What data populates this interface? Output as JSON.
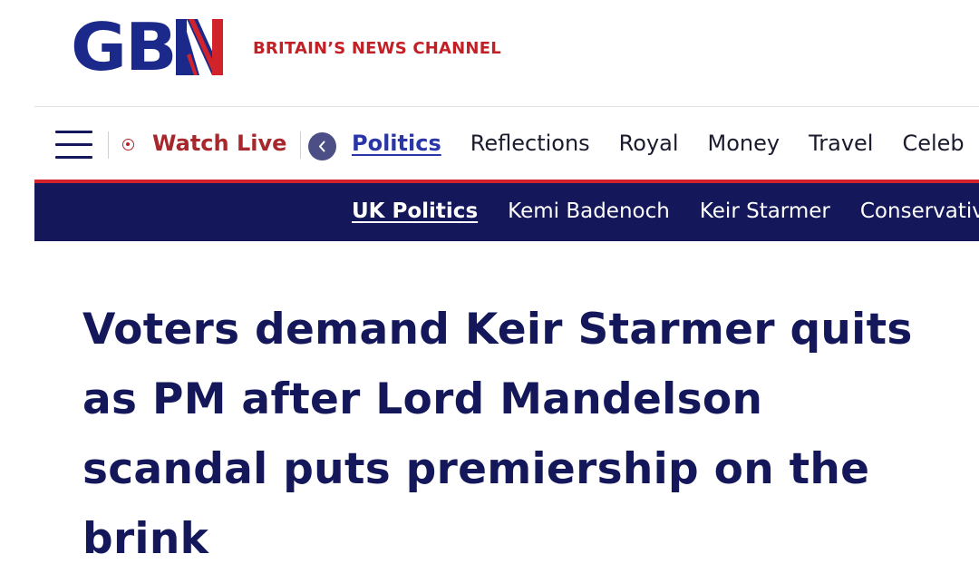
{
  "brand": {
    "logo_text": "GB",
    "logo_glyph": "N",
    "tagline": "BRITAIN’S NEWS CHANNEL",
    "colors": {
      "navy": "#14175a",
      "blue": "#1b2a8a",
      "red": "#c32026"
    }
  },
  "primary_nav": {
    "menu_icon": "hamburger-icon",
    "live_icon": "live-record-icon",
    "watch_live_label": "Watch Live",
    "back_icon": "chevron-left-icon",
    "items": [
      {
        "label": "Politics",
        "active": true
      },
      {
        "label": "Reflections",
        "active": false
      },
      {
        "label": "Royal",
        "active": false
      },
      {
        "label": "Money",
        "active": false
      },
      {
        "label": "Travel",
        "active": false
      },
      {
        "label": "Celeb",
        "active": false
      }
    ]
  },
  "secondary_nav": {
    "items": [
      {
        "label": "UK Politics",
        "active": true
      },
      {
        "label": "Kemi Badenoch",
        "active": false
      },
      {
        "label": "Keir Starmer",
        "active": false
      },
      {
        "label": "Conservatives",
        "active": false
      }
    ]
  },
  "article": {
    "headline": "Voters demand Keir Starmer quits as PM after Lord Mandelson scandal puts premiership on the brink"
  }
}
